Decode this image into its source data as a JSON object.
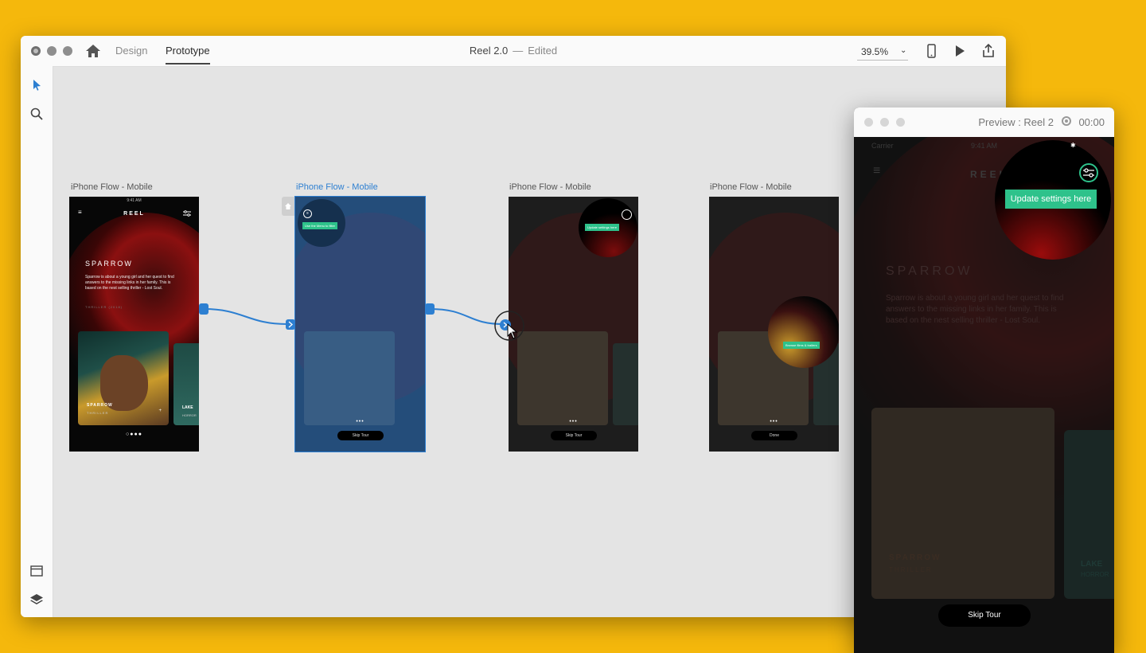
{
  "window": {
    "mode_tabs": {
      "design": "Design",
      "prototype": "Prototype"
    },
    "doc_name": "Reel 2.0",
    "doc_sep": "—",
    "doc_state": "Edited",
    "zoom": "39.5%"
  },
  "artboards": [
    {
      "label": "iPhone Flow - Mobile",
      "brand": "REEL",
      "status": "9:41 AM",
      "title": "SPARROW",
      "desc": "Sparrow is about a young girl and her quest to find answers to the missing links in her family. This is based on the nest selling thriller - Lost Soul.",
      "genre": "THRILLER (2018)",
      "card1_title": "SPARROW",
      "card1_sub": "THRILLER",
      "card2_title": "LAKE",
      "card2_sub": "HORROR"
    },
    {
      "label": "iPhone Flow - Mobile",
      "tooltip": "Use the Menu to filter",
      "button": "Skip Tour"
    },
    {
      "label": "iPhone Flow - Mobile",
      "tooltip": "Update settings here",
      "button": "Skip Tour"
    },
    {
      "label": "iPhone Flow - Mobile",
      "tooltip": "Browse films & trailers",
      "button": "Done"
    }
  ],
  "preview": {
    "title": "Preview : Reel 2",
    "time": "00:00",
    "status_carrier": "Carrier",
    "status_time": "9:41 AM",
    "brand": "REEL",
    "tooltip": "Update settings here",
    "movie_title": "SPARROW",
    "movie_desc": "Sparrow is about a young girl and her quest to find answers to the missing links in her family. This is based on the nest selling thriller - Lost Soul.",
    "card1_title": "SPARROW",
    "card1_sub": "THRILLER",
    "card2_title": "LAKE",
    "card2_sub": "HORROR",
    "skip": "Skip Tour"
  },
  "colors": {
    "accent_blue": "#2d7fd1",
    "tooltip_green": "#2ec28b",
    "background": "#f5b80c"
  }
}
